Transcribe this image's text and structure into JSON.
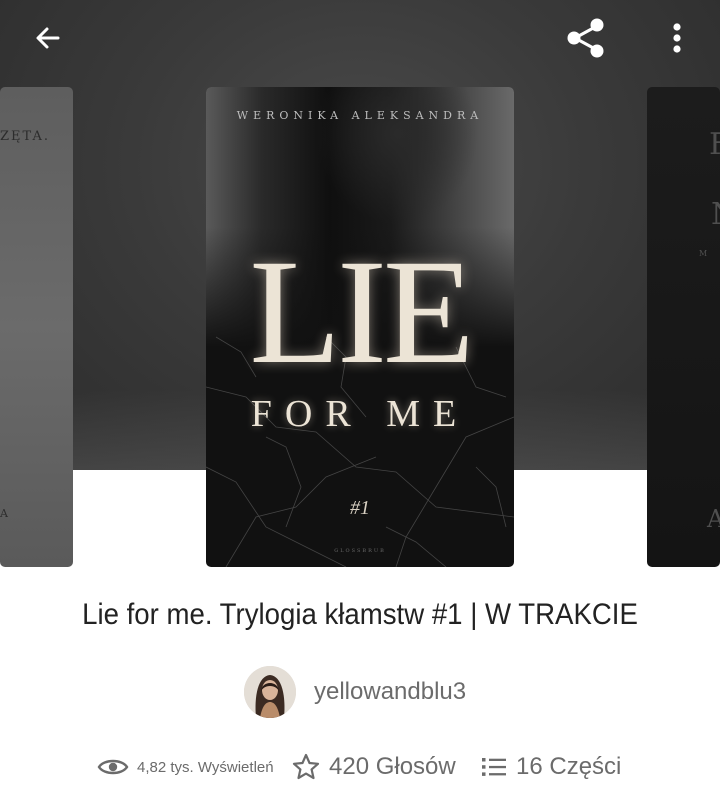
{
  "icons": {
    "back": "arrow-left-icon",
    "share": "share-icon",
    "more": "more-vertical-icon",
    "views": "eye-icon",
    "votes": "star-icon",
    "parts": "list-icon"
  },
  "carousel": {
    "left_cover": {
      "fragment_top": "ZĘTA.",
      "fragment_bottom": "A"
    },
    "right_cover": {
      "fragment_top": "F",
      "fragment_mid": "N",
      "fragment_small": "M",
      "fragment_bottom": "A"
    },
    "main_cover": {
      "author": "WERONIKA ALEKSANDRA",
      "title": "LIE",
      "subtitle": "FOR ME",
      "number": "#1",
      "publisher": "GLOSSBRUB"
    }
  },
  "book": {
    "title": "Lie for me. Trylogia kłamstw #1 | W TRAKCIE",
    "author": "yellowandblu3"
  },
  "stats": {
    "views": "4,82 tys. Wyświetleń",
    "votes": "420 Głosów",
    "parts": "16 Części"
  },
  "colors": {
    "hero_background": "#3a3a3a",
    "text_primary": "#222222",
    "text_secondary": "#6b6b6b",
    "icon_white": "#ffffff"
  }
}
